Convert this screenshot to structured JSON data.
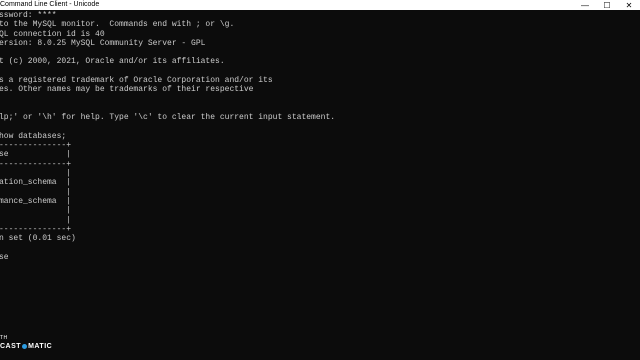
{
  "window": {
    "title": "Command Line Client - Unicode",
    "controls": {
      "minimize": "—",
      "maximize": "☐",
      "close": "✕"
    }
  },
  "console": {
    "lines": [
      "ssword: ****",
      "to the MySQL monitor.  Commands end with ; or \\g.",
      "QL connection id is 40",
      "ersion: 8.0.25 MySQL Community Server - GPL",
      "",
      "t (c) 2000, 2021, Oracle and/or its affiliates.",
      "",
      "s a registered trademark of Oracle Corporation and/or its",
      "es. Other names may be trademarks of their respective",
      "",
      "",
      "lp;' or '\\h' for help. Type '\\c' to clear the current input statement.",
      "",
      "how databases;",
      "--------------+",
      "se            |",
      "--------------+",
      "              |",
      "ation_schema  |",
      "              |",
      "mance_schema  |",
      "              |",
      "              |",
      "--------------+",
      "n set (0.01 sec)",
      "",
      "se"
    ]
  },
  "watermark": {
    "top": "TH",
    "left": "CAST",
    "right": "MATIC"
  }
}
